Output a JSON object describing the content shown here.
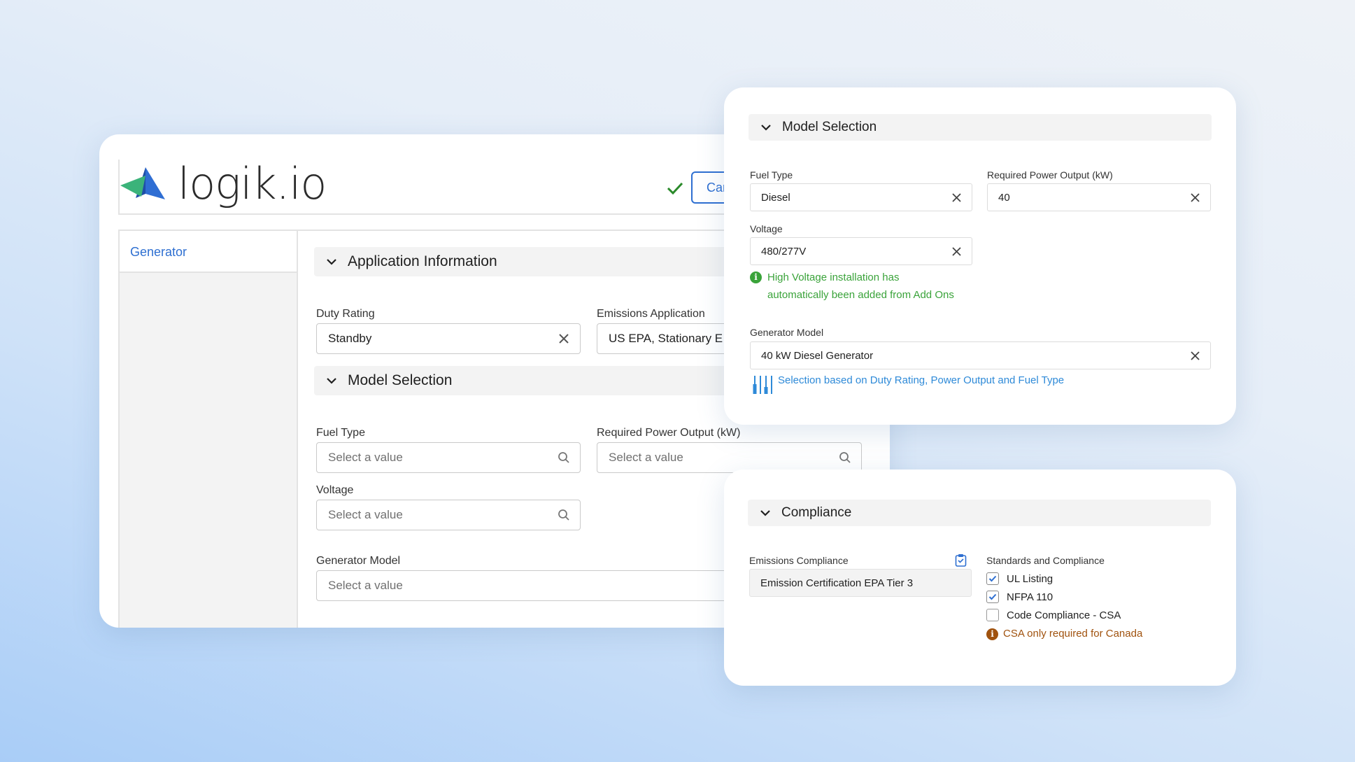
{
  "brand": {
    "name": "logik.io"
  },
  "header": {
    "cancel_label": "Can"
  },
  "sidebar": {
    "items": [
      {
        "label": "Generator"
      }
    ]
  },
  "main": {
    "application_info": {
      "title": "Application Information",
      "duty_rating": {
        "label": "Duty Rating",
        "value": "Standby"
      },
      "emissions_application": {
        "label": "Emissions Application",
        "value": "US EPA, Stationary E"
      }
    },
    "model_selection": {
      "title": "Model Selection",
      "fuel_type": {
        "label": "Fuel Type",
        "placeholder": "Select a value"
      },
      "power_output": {
        "label": "Required Power Output (kW)",
        "placeholder": "Select a value"
      },
      "voltage": {
        "label": "Voltage",
        "placeholder": "Select a value"
      },
      "generator_model": {
        "label": "Generator Model",
        "placeholder": "Select a value"
      }
    }
  },
  "model_card": {
    "title": "Model Selection",
    "fuel_type": {
      "label": "Fuel Type",
      "value": "Diesel"
    },
    "power_output": {
      "label": "Required Power Output (kW)",
      "value": "40"
    },
    "voltage": {
      "label": "Voltage",
      "value": "480/277V"
    },
    "voltage_message": {
      "line1": "High Voltage installation has",
      "line2": "automatically been added from Add Ons"
    },
    "generator_model": {
      "label": "Generator Model",
      "value": "40 kW Diesel Generator"
    },
    "selection_note": "Selection based on Duty Rating, Power Output and Fuel Type"
  },
  "compliance_card": {
    "title": "Compliance",
    "emissions_compliance": {
      "label": "Emissions Compliance",
      "value": "Emission Certification EPA Tier 3"
    },
    "standards": {
      "label": "Standards and Compliance",
      "items": [
        {
          "label": "UL Listing",
          "checked": true
        },
        {
          "label": "NFPA 110",
          "checked": true
        },
        {
          "label": "Code Compliance - CSA",
          "checked": false
        }
      ],
      "note": "CSA only required for Canada"
    }
  },
  "colors": {
    "accent_blue": "#2e6fd1",
    "success_green": "#3aa33a",
    "warning_brown": "#a0520e",
    "info_blue": "#2e8ad8"
  }
}
